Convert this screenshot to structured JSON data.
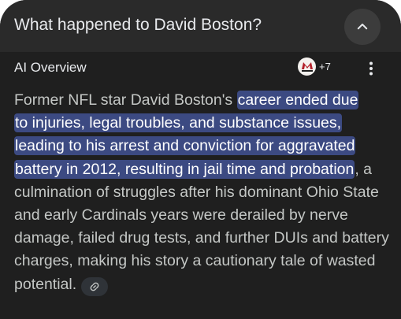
{
  "search": {
    "query": "What happened to David Boston?"
  },
  "overview": {
    "title": "AI Overview",
    "source_count": "+7"
  },
  "answer": {
    "lead": "Former NFL star David Boston's ",
    "highlight_1": "career ended due",
    "highlight_2": "to injuries, legal troubles, and substance issues,",
    "highlight_3": "leading to his arrest and conviction for aggravated",
    "highlight_4": "battery in 2012, resulting in jail time and probation",
    "tail": ", a culmination of struggles after his dominant Ohio State and early Cardinals years were derailed by nerve damage, failed drug tests, and further DUIs and battery charges, making his story a cautionary tale of wasted potential."
  },
  "colors": {
    "card_bg": "#1f1f1f",
    "query_bar_bg": "#2a2a2a",
    "highlight_bg": "#3c4a82",
    "body_text": "#c4c7c5",
    "title_text": "#e8eaed"
  }
}
